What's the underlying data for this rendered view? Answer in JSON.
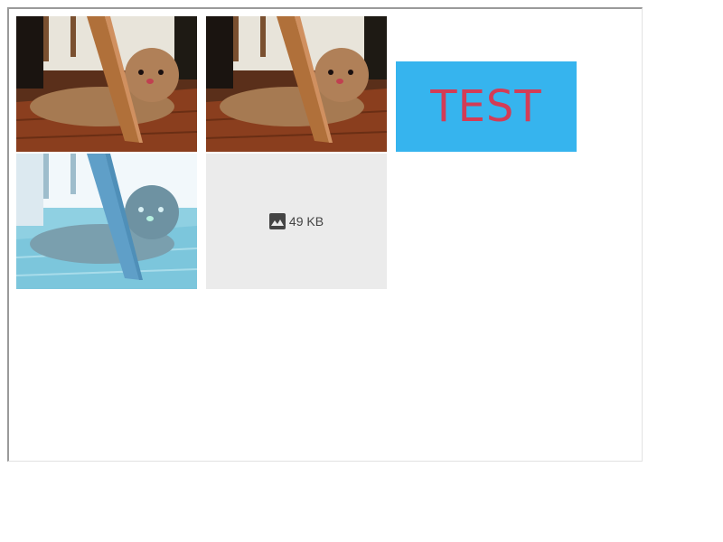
{
  "colors": {
    "test_background": "#36b4ee",
    "test_text": "#d33c56",
    "placeholder_background": "#ebebeb"
  },
  "images": [
    {
      "name": "puppy-under-chair",
      "style": "original"
    },
    {
      "name": "puppy-under-chair",
      "style": "original"
    },
    {
      "name": "test-banner",
      "text": "TEST"
    },
    {
      "name": "puppy-under-chair",
      "style": "inverted-tint"
    },
    {
      "name": "image-placeholder",
      "icon": "image-icon",
      "size_label": "49 KB"
    }
  ]
}
